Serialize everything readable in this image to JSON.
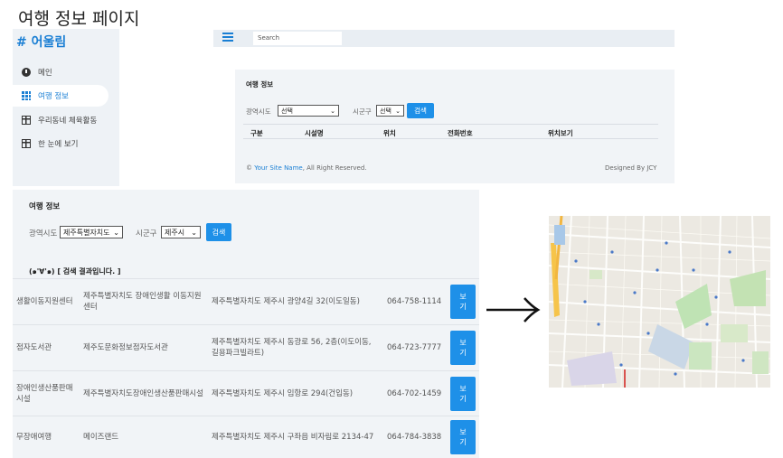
{
  "page_heading": "여행 정보 페이지",
  "sidebar": {
    "brand": "# 어울림",
    "items": [
      {
        "label": "메인",
        "icon": "gauge-icon",
        "active": false
      },
      {
        "label": "여행 정보",
        "icon": "grid-icon",
        "active": true
      },
      {
        "label": "우리동네 체육활동",
        "icon": "table-icon",
        "active": false
      },
      {
        "label": "한 눈에 보기",
        "icon": "table-icon",
        "active": false
      }
    ]
  },
  "topbar": {
    "menu_icon": "hamburger-icon",
    "search_placeholder": "Search"
  },
  "panel_small": {
    "title": "여행 정보",
    "province_label": "광역시도",
    "province_value": "선택",
    "district_label": "시군구",
    "district_value": "선택",
    "search_button": "검색",
    "columns": [
      "구분",
      "시설명",
      "위치",
      "전화번호",
      "위치보기"
    ],
    "footer_prefix": "© ",
    "footer_link": "Your Site Name",
    "footer_suffix": ", All Right Reserved.",
    "footer_right": "Designed By JCY"
  },
  "panel_large": {
    "title": "여행 정보",
    "province_label": "광역시도",
    "province_value": "제주특별자치도",
    "district_label": "시군구",
    "district_value": "제주시",
    "search_button": "검색",
    "result_note": "(๑'∀'๑) [ 검색 결과입니다. ]",
    "view_label_1": "보",
    "view_label_2": "기",
    "rows": [
      {
        "category": "생활이동지원센터",
        "name": "제주특별자치도 장애인생활 이동지원센터",
        "address": "제주특별자치도 제주시 광양4길 32(이도일동)",
        "phone": "064-758-1114"
      },
      {
        "category": "점자도서관",
        "name": "제주도문화정보점자도서관",
        "address": "제주특별자치도 제주시 동광로 56, 2층(이도이동, 길용파크빌라트)",
        "phone": "064-723-7777"
      },
      {
        "category": "장애인생산품판매시설",
        "name": "제주특별자치도장애인생산품판매시설",
        "address": "제주특별자치도 제주시 임항로 294(건입동)",
        "phone": "064-702-1459"
      },
      {
        "category": "무장애여행",
        "name": "메이즈랜드",
        "address": "제주특별자치도 제주시 구좌읍 비자림로 2134-47",
        "phone": "064-784-3838"
      }
    ]
  },
  "colors": {
    "accent": "#1e90e8",
    "panel_bg": "#f1f4f7",
    "sidebar_bg": "#eef2f6"
  },
  "arrow_icon": "right-arrow-icon",
  "map_icon": "street-map-image"
}
